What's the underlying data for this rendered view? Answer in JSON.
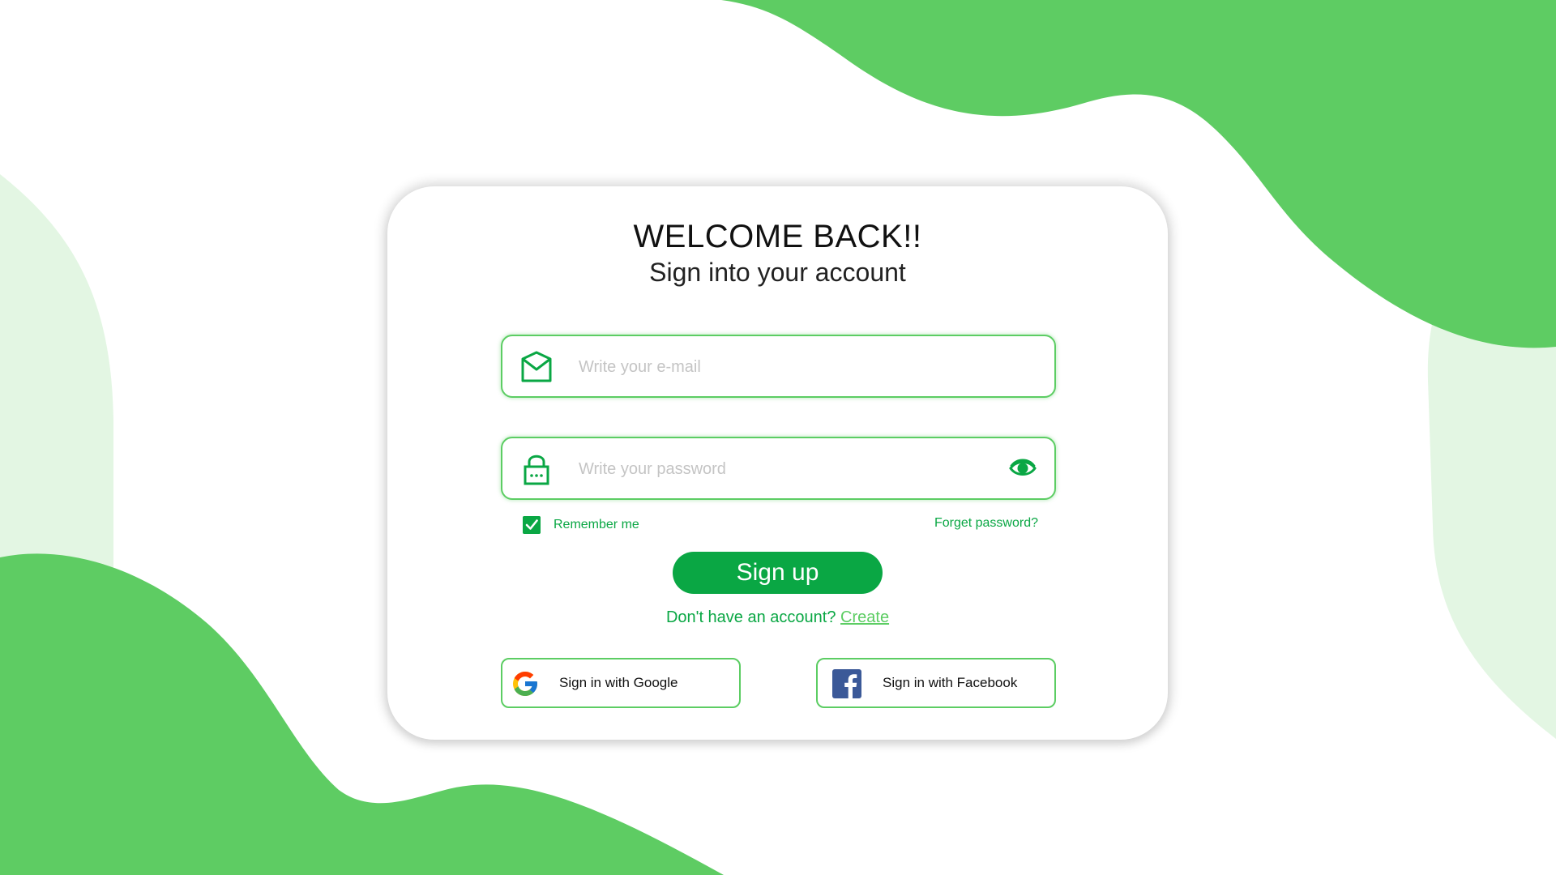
{
  "header": {
    "title": "WELCOME BACK!!",
    "subtitle": "Sign into your account"
  },
  "form": {
    "email": {
      "placeholder": "Write your e-mail",
      "value": "",
      "icon": "envelope-icon"
    },
    "password": {
      "placeholder": "Write your password",
      "value": "",
      "icon": "lock-icon",
      "toggle_icon": "eye-icon"
    },
    "remember_label": "Remember me",
    "remember_checked": true,
    "forgot_label": "Forget password?",
    "submit_label": "Sign up",
    "no_account_text": "Don't have an account?",
    "create_label": "Create"
  },
  "social": {
    "google_label": "Sign in with Google",
    "facebook_label": "Sign in with Facebook"
  },
  "colors": {
    "accent": "#0aa744",
    "accent_light": "#5ccd63",
    "blob": "#5ecc63",
    "blob_pale": "#e3f6e3",
    "facebook": "#3b5998"
  }
}
